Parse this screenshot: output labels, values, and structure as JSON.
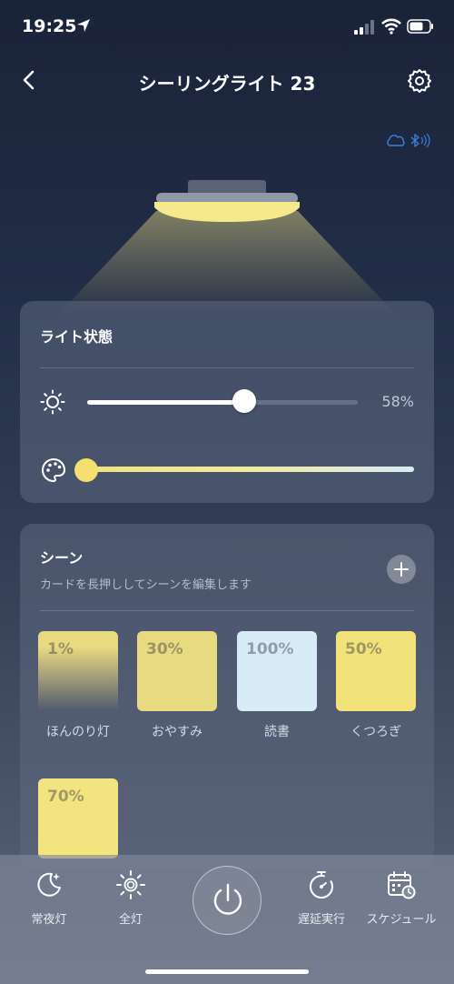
{
  "status_bar": {
    "time": "19:25"
  },
  "header": {
    "title": "シーリングライト 23"
  },
  "light_state": {
    "title": "ライト状態",
    "brightness_percent": 58,
    "brightness_label": "58%",
    "color_temp_fraction": 0.0
  },
  "scenes": {
    "title": "シーン",
    "subtitle": "カードを長押ししてシーンを編集します",
    "items": [
      {
        "percent": "1%",
        "name": "ほんのり灯",
        "color": "#e8da80",
        "fade": true
      },
      {
        "percent": "30%",
        "name": "おやすみ",
        "color": "#e8da80"
      },
      {
        "percent": "100%",
        "name": "読書",
        "color": "#d8ecf8"
      },
      {
        "percent": "50%",
        "name": "くつろぎ",
        "color": "#f1e27a"
      },
      {
        "percent": "70%",
        "name": "",
        "color": "#f2e47e"
      }
    ]
  },
  "tabs": [
    {
      "label": "常夜灯",
      "icon": "moon-icon"
    },
    {
      "label": "全灯",
      "icon": "sun-icon"
    },
    {
      "label": "遅延実行",
      "icon": "timer-icon"
    },
    {
      "label": "スケジュール",
      "icon": "schedule-icon"
    }
  ],
  "colors": {
    "warm": "#f1e27a",
    "cool": "#d8ecf8",
    "accent": "#3c7ee0"
  }
}
